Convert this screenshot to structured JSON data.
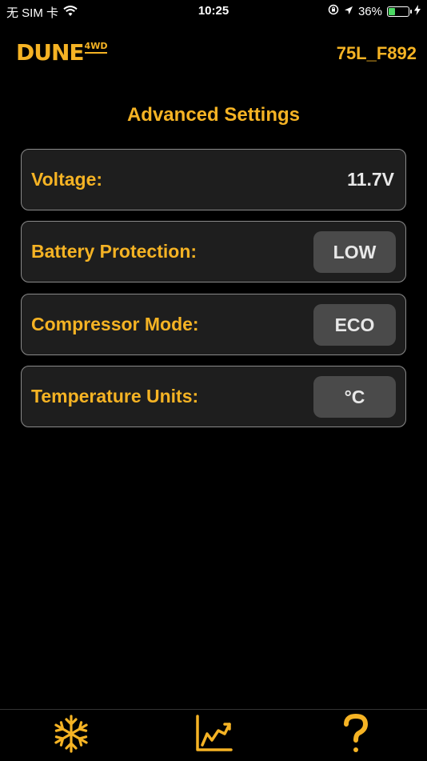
{
  "status_bar": {
    "carrier": "无 SIM 卡",
    "time": "10:25",
    "battery_percent": "36%",
    "battery_level": 0.36
  },
  "header": {
    "logo_main": "DUNE",
    "logo_sup": "4WD",
    "device_id": "75L_F892"
  },
  "page": {
    "title": "Advanced Settings"
  },
  "settings": {
    "voltage": {
      "label": "Voltage:",
      "value": "11.7V"
    },
    "battery_protection": {
      "label": "Battery Protection:",
      "value": "LOW"
    },
    "compressor_mode": {
      "label": "Compressor Mode:",
      "value": "ECO"
    },
    "temperature_units": {
      "label": "Temperature Units:",
      "value": "°C"
    }
  },
  "tabs": [
    {
      "icon": "snowflake-icon"
    },
    {
      "icon": "line-chart-icon"
    },
    {
      "icon": "question-mark-icon"
    }
  ],
  "colors": {
    "accent": "#f5b324",
    "background": "#000000",
    "row_background": "#1e1e1e",
    "button_background": "#4a4a4a",
    "battery_fill": "#4cd964"
  }
}
